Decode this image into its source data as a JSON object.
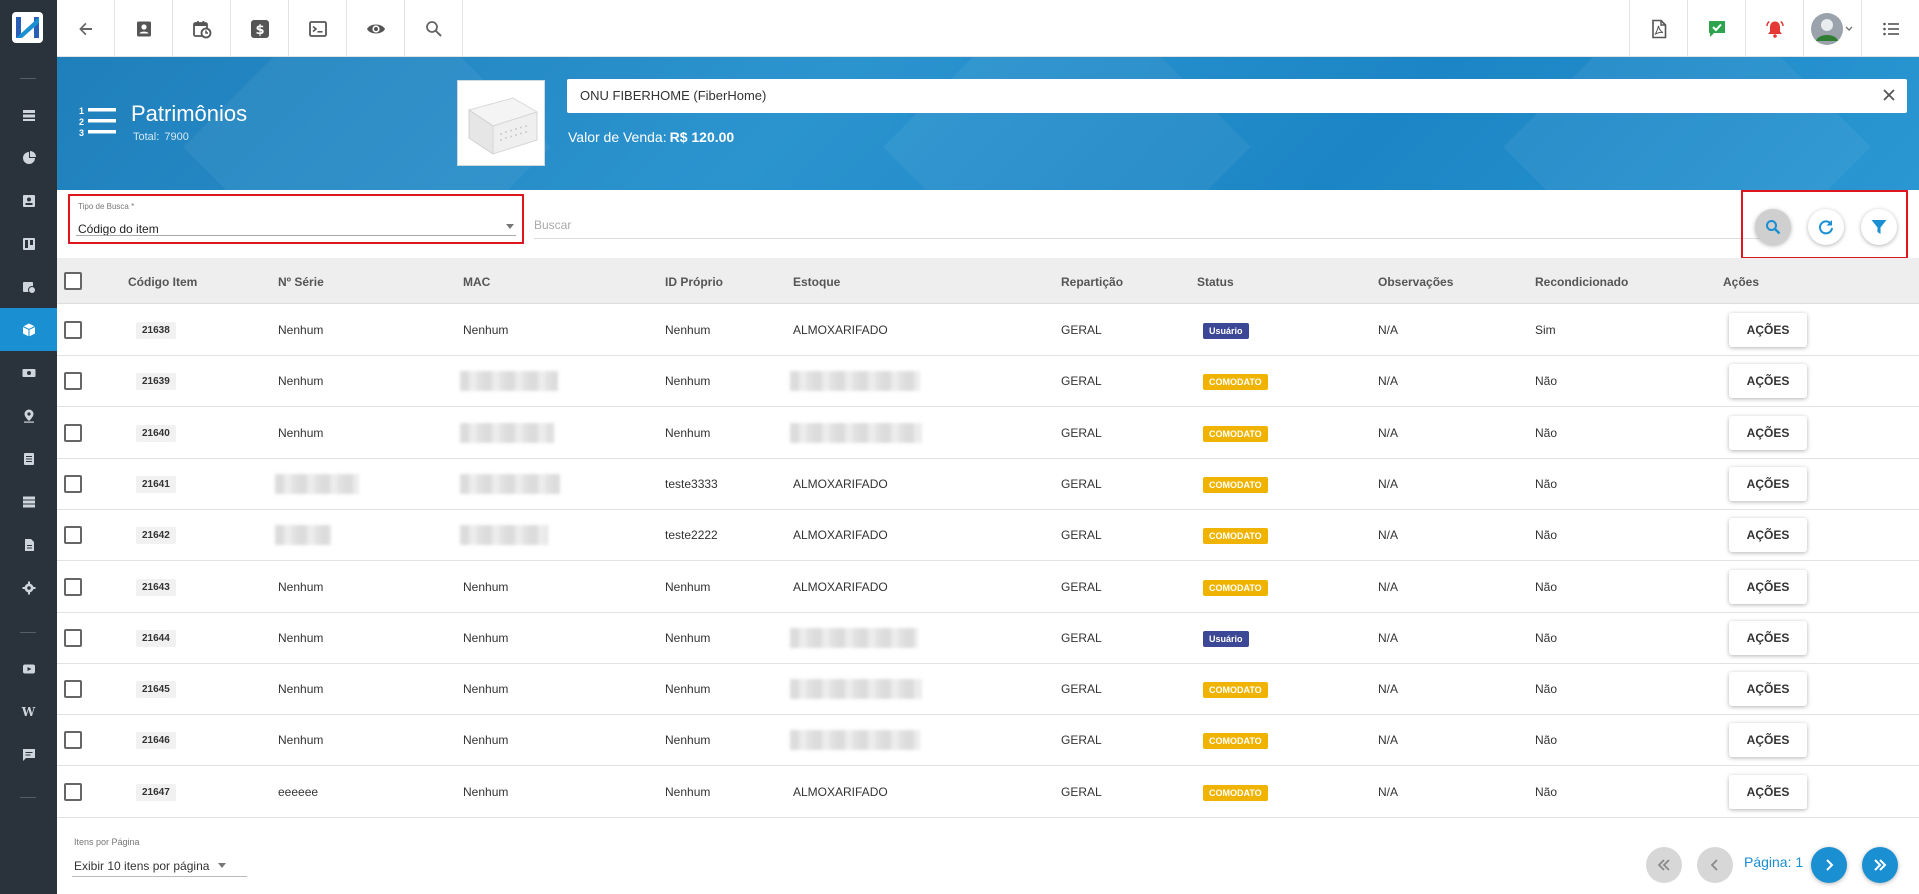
{
  "header": {
    "title": "Patrimônios",
    "total_label": "Total:",
    "total_value": "7900",
    "product_name": "ONU FIBERHOME  (FiberHome)",
    "price_label": "Valor de Venda:",
    "price_value": "R$ 120.00"
  },
  "search": {
    "tipo_label": "Tipo de Busca *",
    "tipo_value": "Código do item",
    "buscar_placeholder": "Buscar"
  },
  "table": {
    "columns": [
      "Código Item",
      "Nº Série",
      "MAC",
      "ID Próprio",
      "Estoque",
      "Repartição",
      "Status",
      "Observações",
      "Recondicionado",
      "Ações"
    ],
    "action_label": "AÇÕES",
    "rows": [
      {
        "code": "21638",
        "serie": "Nenhum",
        "mac": "Nenhum",
        "id": "Nenhum",
        "estoque": "ALMOXARIFADO",
        "reparticao": "GERAL",
        "status": "Usuário",
        "status_type": "usuario",
        "obs": "N/A",
        "recond": "Sim"
      },
      {
        "code": "21639",
        "serie": "Nenhum",
        "mac": "",
        "id": "Nenhum",
        "estoque": "",
        "reparticao": "GERAL",
        "status": "COMODATO",
        "status_type": "comodato",
        "obs": "N/A",
        "recond": "Não"
      },
      {
        "code": "21640",
        "serie": "Nenhum",
        "mac": "",
        "id": "Nenhum",
        "estoque": "",
        "reparticao": "GERAL",
        "status": "COMODATO",
        "status_type": "comodato",
        "obs": "N/A",
        "recond": "Não"
      },
      {
        "code": "21641",
        "serie": "",
        "mac": "",
        "id": "teste3333",
        "estoque": "ALMOXARIFADO",
        "reparticao": "GERAL",
        "status": "COMODATO",
        "status_type": "comodato",
        "obs": "N/A",
        "recond": "Não"
      },
      {
        "code": "21642",
        "serie": "",
        "mac": "",
        "id": "teste2222",
        "estoque": "ALMOXARIFADO",
        "reparticao": "GERAL",
        "status": "COMODATO",
        "status_type": "comodato",
        "obs": "N/A",
        "recond": "Não"
      },
      {
        "code": "21643",
        "serie": "Nenhum",
        "mac": "Nenhum",
        "id": "Nenhum",
        "estoque": "ALMOXARIFADO",
        "reparticao": "GERAL",
        "status": "COMODATO",
        "status_type": "comodato",
        "obs": "N/A",
        "recond": "Não"
      },
      {
        "code": "21644",
        "serie": "Nenhum",
        "mac": "Nenhum",
        "id": "Nenhum",
        "estoque": "",
        "reparticao": "GERAL",
        "status": "Usuário",
        "status_type": "usuario",
        "obs": "N/A",
        "recond": "Não"
      },
      {
        "code": "21645",
        "serie": "Nenhum",
        "mac": "Nenhum",
        "id": "Nenhum",
        "estoque": "",
        "reparticao": "GERAL",
        "status": "COMODATO",
        "status_type": "comodato",
        "obs": "N/A",
        "recond": "Não"
      },
      {
        "code": "21646",
        "serie": "Nenhum",
        "mac": "Nenhum",
        "id": "Nenhum",
        "estoque": "",
        "reparticao": "GERAL",
        "status": "COMODATO",
        "status_type": "comodato",
        "obs": "N/A",
        "recond": "Não"
      },
      {
        "code": "21647",
        "serie": "eeeeee",
        "mac": "Nenhum",
        "id": "Nenhum",
        "estoque": "ALMOXARIFADO",
        "reparticao": "GERAL",
        "status": "COMODATO",
        "status_type": "comodato",
        "obs": "N/A",
        "recond": "Não"
      }
    ]
  },
  "footer": {
    "items_label": "Itens por Página",
    "items_value": "Exibir 10 itens por página",
    "page_label": "Página: 1"
  },
  "sidebar": {
    "items": [
      "dashboard-icon",
      "chart-pie-icon",
      "contact-icon",
      "board-icon",
      "calendar-clock-icon",
      "package-icon",
      "money-icon",
      "map-pin-icon",
      "document-icon",
      "server-icon",
      "file-icon",
      "settings-icon",
      "video-icon",
      "wiki-icon",
      "chat-icon"
    ],
    "active": "package-icon"
  },
  "colors": {
    "sidebar_bg": "#2a323c",
    "accent": "#1a8fd1",
    "usuario_badge": "#3c4796",
    "comodato_badge": "#f0b400",
    "highlight_red": "#e0161f"
  }
}
